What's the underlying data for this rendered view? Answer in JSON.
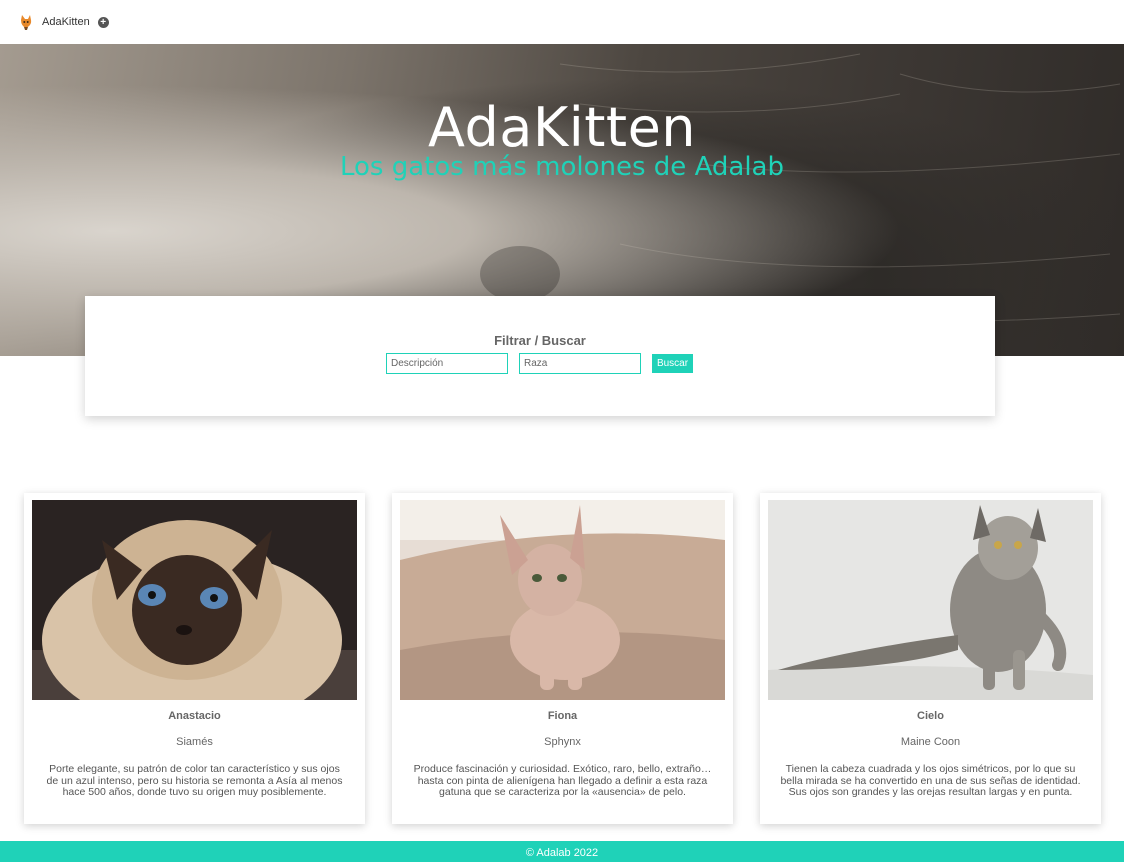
{
  "nav": {
    "brand": "AdaKitten",
    "plus_icon": "plus-circle-icon",
    "logo_icon": "kitten-logo-icon"
  },
  "hero": {
    "title": "AdaKitten",
    "subtitle": "Los gatos más molones de Adalab"
  },
  "filter": {
    "title": "Filtrar / Buscar",
    "description_placeholder": "Descripción",
    "race_placeholder": "Raza",
    "search_label": "Buscar"
  },
  "cats": [
    {
      "name": "Anastacio",
      "race": "Siamés",
      "description": "Porte elegante, su patrón de color tan característico y sus ojos de un azul intenso, pero su historia se remonta a Asía al menos hace 500 años, donde tuvo su origen muy posiblemente."
    },
    {
      "name": "Fiona",
      "race": "Sphynx",
      "description": "Produce fascinación y curiosidad. Exótico, raro, bello, extraño… hasta con pinta de alienígena han llegado a definir a esta raza gatuna que se caracteriza por la «ausencia» de pelo."
    },
    {
      "name": "Cielo",
      "race": "Maine Coon",
      "description": "Tienen la cabeza cuadrada y los ojos simétricos, por lo que su bella mirada se ha convertido en una de sus señas de identidad. Sus ojos son grandes y las orejas resultan largas y en punta."
    }
  ],
  "footer": {
    "text": "© Adalab 2022"
  },
  "colors": {
    "accent": "#1fd2b8",
    "text": "#666666"
  }
}
